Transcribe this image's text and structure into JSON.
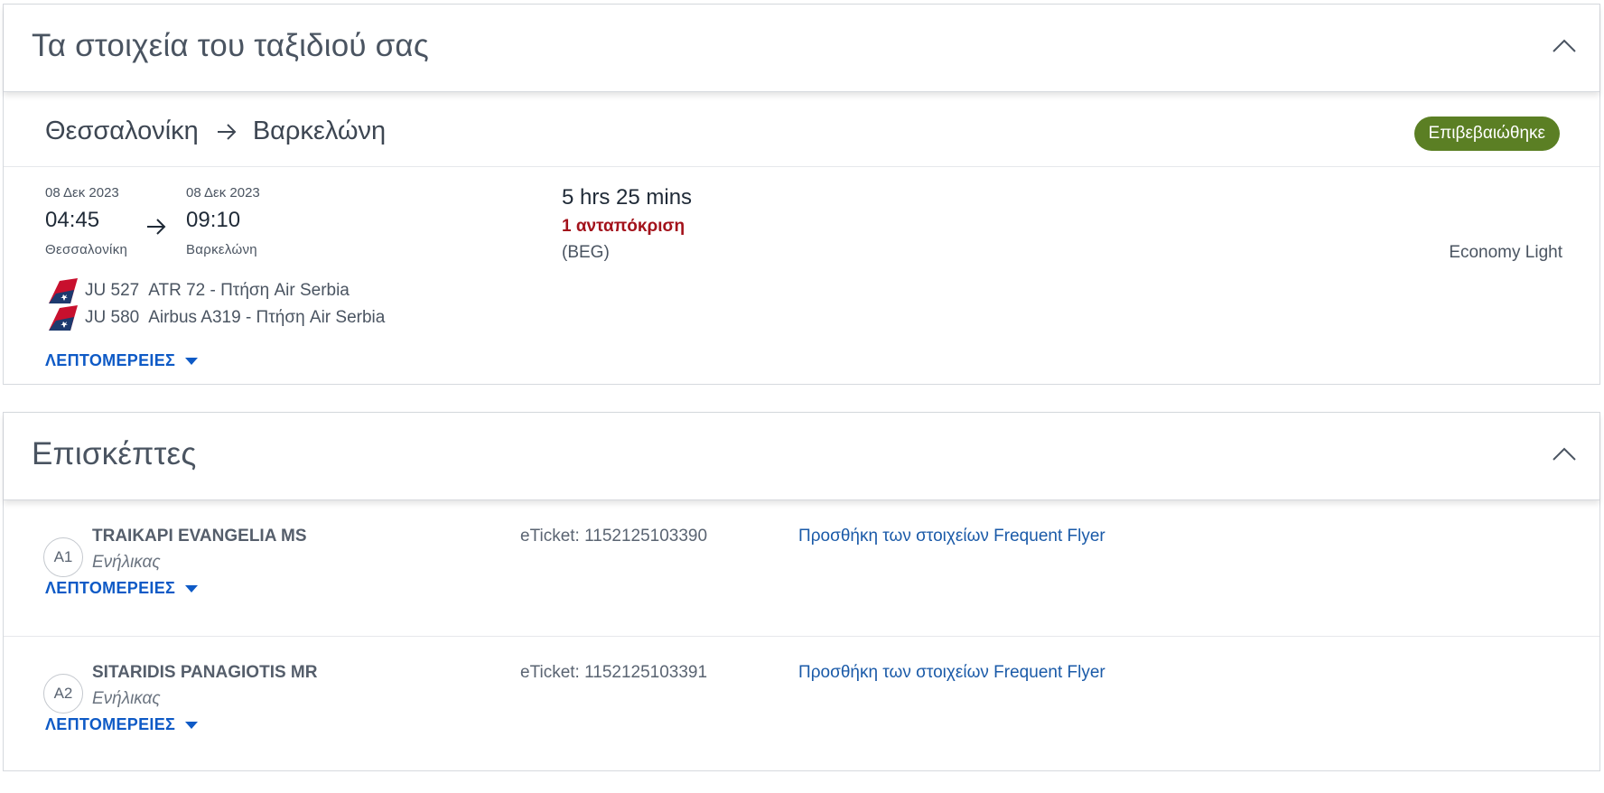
{
  "trip_panel": {
    "title": "Τα στοιχεία του ταξιδιού σας",
    "origin": "Θεσσαλονίκη",
    "destination": "Βαρκελώνη",
    "status": "Επιβεβαιώθηκε",
    "departure": {
      "date": "08 Δεκ 2023",
      "time": "04:45",
      "city": "Θεσσαλονίκη"
    },
    "arrival": {
      "date": "08 Δεκ 2023",
      "time": "09:10",
      "city": "Βαρκελώνη"
    },
    "duration": "5 hrs 25 mins",
    "stops": "1 ανταπόκριση",
    "via": "(BEG)",
    "cabin": "Economy Light",
    "operators": [
      {
        "flight": "JU  527",
        "text": "ATR 72 - Πτήση Air Serbia"
      },
      {
        "flight": "JU  580",
        "text": "Airbus A319 - Πτήση Air Serbia"
      }
    ],
    "details_label": "ΛΕΠΤΟΜΕΡΕΙΕΣ"
  },
  "passengers_panel": {
    "title": "Επισκέπτες",
    "passengers": [
      {
        "badge": "A1",
        "name": "TRAIKAPI EVANGELIA MS",
        "type": "Ενήλικας",
        "ticket": "eTicket: 1152125103390",
        "ff_link": "Προσθήκη των στοιχείων Frequent Flyer",
        "details_label": "ΛΕΠΤΟΜΕΡΕΙΕΣ"
      },
      {
        "badge": "A2",
        "name": "SITARIDIS PANAGIOTIS MR",
        "type": "Ενήλικας",
        "ticket": "eTicket: 1152125103391",
        "ff_link": "Προσθήκη των στοιχείων Frequent Flyer",
        "details_label": "ΛΕΠΤΟΜΕΡΕΙΕΣ"
      }
    ]
  },
  "icons": {
    "collapse": "chevron-up-icon",
    "arrow": "arrow-right-icon",
    "airline": "air-serbia-tail-icon",
    "caret": "caret-down-icon"
  },
  "colors": {
    "status_badge": "#5b7f24",
    "stops_text": "#a3121b",
    "link_bold": "#0e5ac6",
    "link": "#1a5aa8"
  }
}
